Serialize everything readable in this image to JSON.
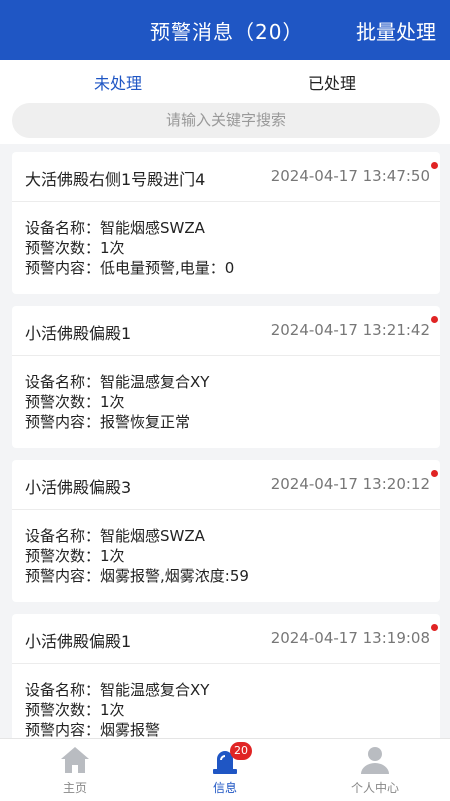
{
  "header": {
    "title": "预警消息（20）",
    "batch_label": "批量处理"
  },
  "tabs": [
    {
      "label": "未处理"
    },
    {
      "label": "已处理"
    }
  ],
  "search": {
    "placeholder": "请输入关键字搜索"
  },
  "labels": {
    "device": "设备名称：",
    "count": "预警次数：",
    "content": "预警内容："
  },
  "alerts": [
    {
      "location": "大活佛殿右侧1号殿进门4",
      "time": "2024-04-17 13:47:50",
      "device": "智能烟感SWZA",
      "count": "1次",
      "content": "低电量预警,电量：0"
    },
    {
      "location": "小活佛殿偏殿1",
      "time": "2024-04-17 13:21:42",
      "device": "智能温感复合XY",
      "count": "1次",
      "content": "报警恢复正常"
    },
    {
      "location": "小活佛殿偏殿3",
      "time": "2024-04-17 13:20:12",
      "device": "智能烟感SWZA",
      "count": "1次",
      "content": "烟雾报警,烟雾浓度:59"
    },
    {
      "location": "小活佛殿偏殿1",
      "time": "2024-04-17 13:19:08",
      "device": "智能温感复合XY",
      "count": "1次",
      "content": "烟雾报警"
    }
  ],
  "nav": [
    {
      "label": "主页",
      "icon": "home-icon"
    },
    {
      "label": "信息",
      "icon": "alarm-light-icon",
      "badge": "20"
    },
    {
      "label": "个人中心",
      "icon": "user-icon"
    }
  ],
  "colors": {
    "primary": "#1f56c4",
    "alert_dot": "#e02424"
  }
}
